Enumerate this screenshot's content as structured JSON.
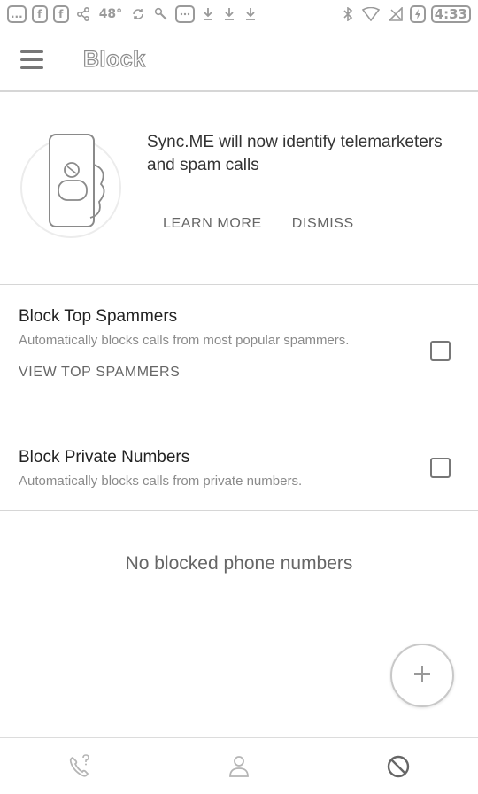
{
  "status_bar": {
    "left_icons": [
      "...",
      "f",
      "f",
      "share-icon",
      "48°",
      "sync-icon",
      "wrench-icon",
      "message-icon",
      "download-icon",
      "download-icon",
      "download-icon"
    ],
    "time": "4:33"
  },
  "app_bar": {
    "title": "Block"
  },
  "promo": {
    "text": "Sync.ME will now identify telemarketers and spam calls",
    "learn_more": "LEARN MORE",
    "dismiss": "DISMISS"
  },
  "settings": [
    {
      "title": "Block Top Spammers",
      "description": "Automatically blocks calls from most popular spammers.",
      "checked": false,
      "action": "VIEW TOP SPAMMERS"
    },
    {
      "title": "Block Private Numbers",
      "description": "Automatically blocks calls from private numbers.",
      "checked": false
    }
  ],
  "empty_state": "No blocked phone numbers",
  "fab": {
    "icon": "plus-icon"
  },
  "bottom_nav": [
    {
      "icon": "call-unknown-icon"
    },
    {
      "icon": "person-icon"
    },
    {
      "icon": "block-icon",
      "active": true
    }
  ],
  "colors": {
    "divider": "#d6d6d6",
    "text_primary": "#222222",
    "text_secondary": "#8a8a8a"
  }
}
